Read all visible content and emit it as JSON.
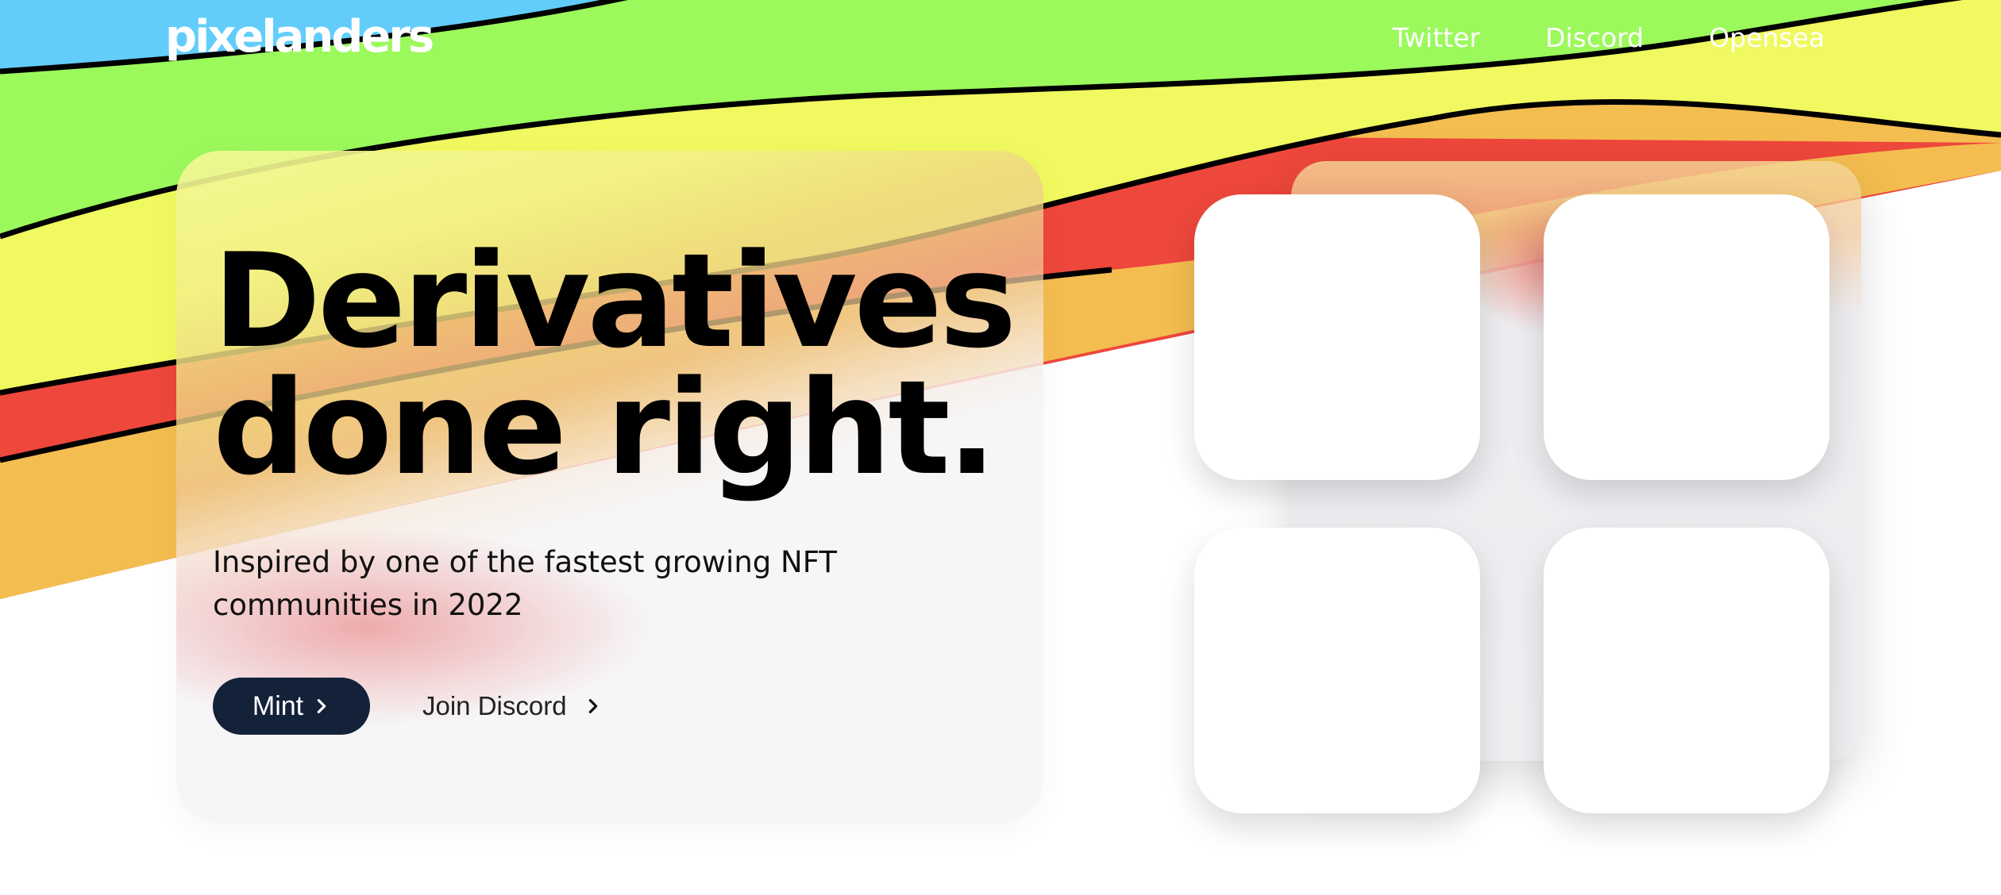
{
  "nav": {
    "logo": "pixelanders",
    "links": [
      "Twitter",
      "Discord",
      "Opensea"
    ]
  },
  "hero": {
    "headline_line1": "Derivatives",
    "headline_line2": "done right.",
    "subtitle": "Inspired by one of the fastest growing NFT communities in 2022",
    "mint_label": "Mint",
    "join_label": "Join Discord"
  },
  "colors": {
    "sky": "#62cdfb",
    "green": "#9bf95c",
    "yellow": "#f0f95f",
    "orange": "#f4bd50",
    "red": "#ee473b",
    "button": "#132139"
  },
  "icons": [
    "chevron-right-icon"
  ]
}
